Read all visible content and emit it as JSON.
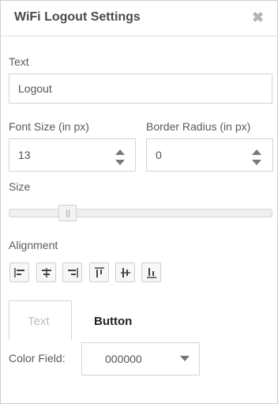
{
  "header": {
    "title": "WiFi Logout Settings",
    "close_icon": "close-icon"
  },
  "fields": {
    "text": {
      "label": "Text",
      "value": "Logout"
    },
    "font_size": {
      "label": "Font Size (in px)",
      "value": "13"
    },
    "border_radius": {
      "label": "Border Radius (in px)",
      "value": "0"
    },
    "size": {
      "label": "Size"
    },
    "alignment": {
      "label": "Alignment",
      "icons": [
        "align-left-icon",
        "align-center-icon",
        "align-right-icon",
        "align-top-icon",
        "align-middle-icon",
        "align-bottom-icon"
      ]
    }
  },
  "tabs": [
    {
      "label": "Text",
      "active": true
    },
    {
      "label": "Button",
      "active": false
    }
  ],
  "color_field": {
    "label": "Color Field:",
    "value": "000000"
  },
  "colors": {
    "border": "#d4d4d4",
    "text": "#555555"
  }
}
